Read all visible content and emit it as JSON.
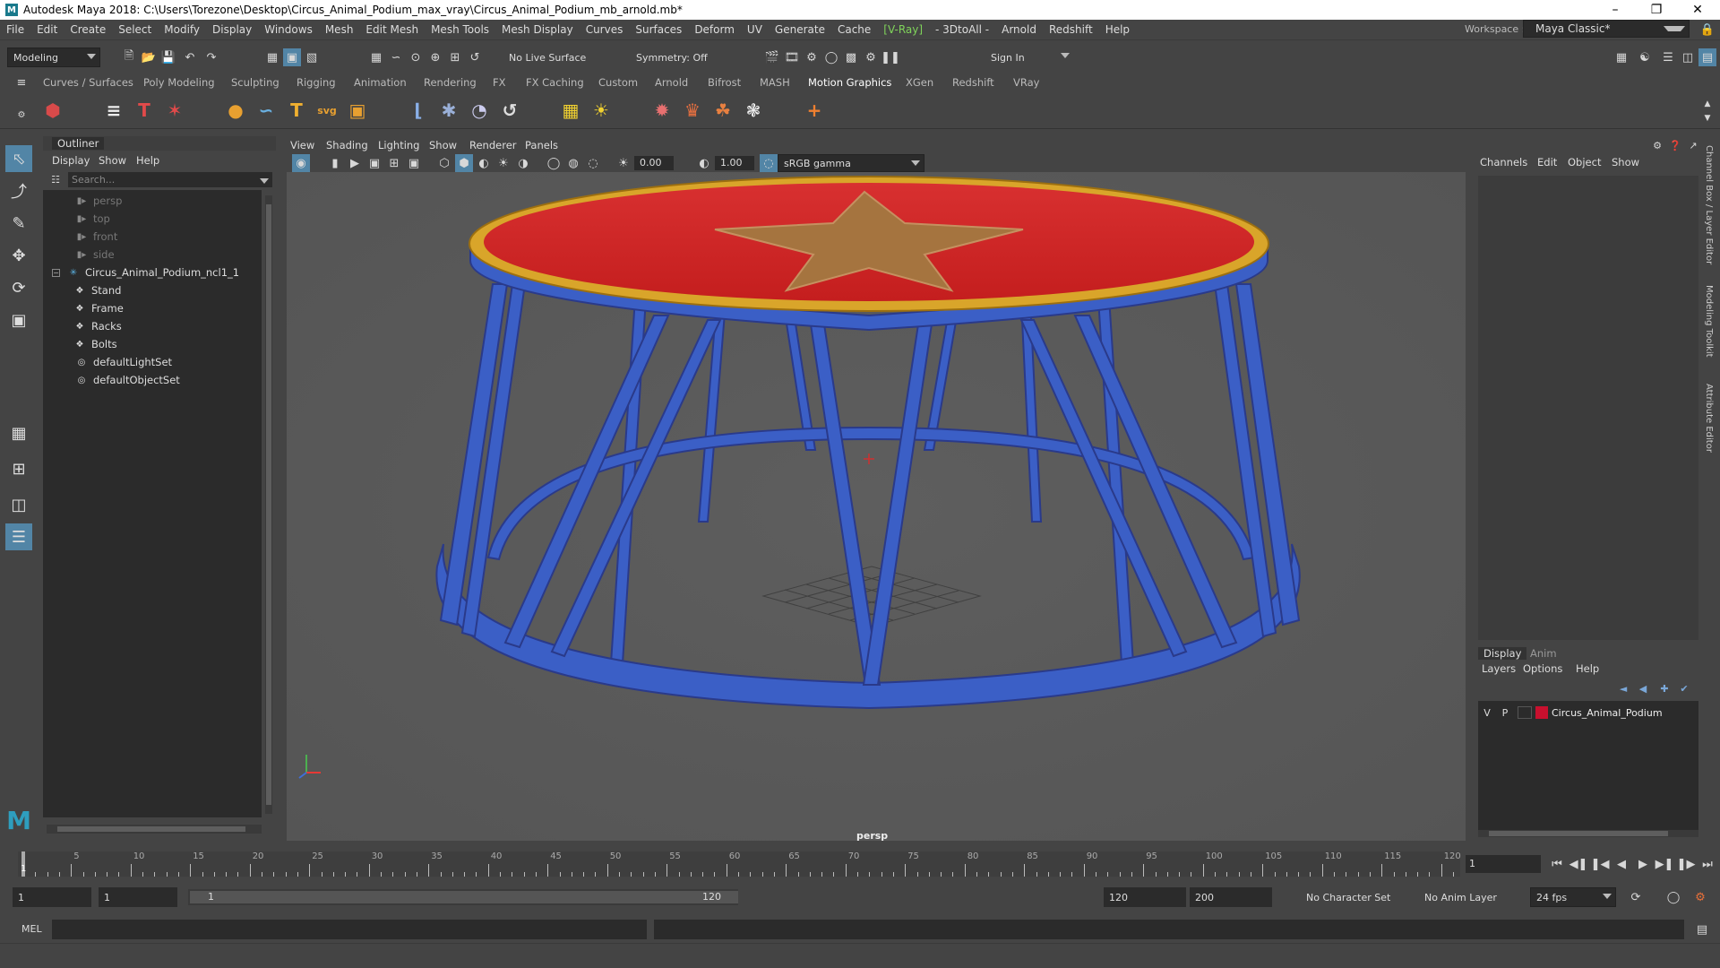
{
  "window": {
    "title": "Autodesk Maya 2018: C:\\Users\\Torezone\\Desktop\\Circus_Animal_Podium_max_vray\\Circus_Animal_Podium_mb_arnold.mb*",
    "logo": "M"
  },
  "menu": [
    "File",
    "Edit",
    "Create",
    "Select",
    "Modify",
    "Display",
    "Windows",
    "Mesh",
    "Edit Mesh",
    "Mesh Tools",
    "Mesh Display",
    "Curves",
    "Surfaces",
    "Deform",
    "UV",
    "Generate",
    "Cache",
    "[V-Ray]",
    "- 3DtoAll -",
    "Arnold",
    "Redshift",
    "Help"
  ],
  "workspace": {
    "label": "Workspace :",
    "value": "Maya Classic*"
  },
  "status": {
    "mode": "Modeling",
    "live_surface": "No Live Surface",
    "symmetry": "Symmetry: Off",
    "sign_in": "Sign In"
  },
  "shelf_tabs": [
    "Curves / Surfaces",
    "Poly Modeling",
    "Sculpting",
    "Rigging",
    "Animation",
    "Rendering",
    "FX",
    "FX Caching",
    "Custom",
    "Arnold",
    "Bifrost",
    "MASH",
    "Motion Graphics",
    "XGen",
    "Redshift",
    "VRay"
  ],
  "shelf_active": "Motion Graphics",
  "outliner": {
    "title": "Outliner",
    "menu": [
      "Display",
      "Show",
      "Help"
    ],
    "search_placeholder": "Search...",
    "items": [
      {
        "label": "persp",
        "type": "camera"
      },
      {
        "label": "top",
        "type": "camera"
      },
      {
        "label": "front",
        "type": "camera"
      },
      {
        "label": "side",
        "type": "camera"
      },
      {
        "label": "Circus_Animal_Podium_ncl1_1",
        "type": "group"
      },
      {
        "label": "Stand",
        "type": "mesh"
      },
      {
        "label": "Frame",
        "type": "mesh"
      },
      {
        "label": "Racks",
        "type": "mesh"
      },
      {
        "label": "Bolts",
        "type": "mesh"
      },
      {
        "label": "defaultLightSet",
        "type": "set"
      },
      {
        "label": "defaultObjectSet",
        "type": "set"
      }
    ]
  },
  "viewport": {
    "menu": [
      "View",
      "Shading",
      "Lighting",
      "Show",
      "Renderer",
      "Panels"
    ],
    "exposure": "0.00",
    "gamma": "1.00",
    "color_space": "sRGB gamma",
    "camera_label": "persp"
  },
  "channel_box": {
    "menu": [
      "Channels",
      "Edit",
      "Object",
      "Show"
    ]
  },
  "layer_editor": {
    "tabs": [
      "Display",
      "Anim"
    ],
    "menu": [
      "Layers",
      "Options",
      "Help"
    ],
    "layer": {
      "v": "V",
      "p": "P",
      "name": "Circus_Animal_Podium",
      "color": "#c8102e"
    }
  },
  "side_tabs": [
    "Channel Box / Layer Editor",
    "Modeling Toolkit",
    "Attribute Editor"
  ],
  "timeline": {
    "ticks": [
      "5",
      "10",
      "15",
      "20",
      "25",
      "30",
      "35",
      "40",
      "45",
      "50",
      "55",
      "60",
      "65",
      "70",
      "75",
      "80",
      "85",
      "90",
      "95",
      "100",
      "105",
      "110",
      "115",
      "120"
    ],
    "current_frame": "1",
    "current_frame_label": "1"
  },
  "range": {
    "start": "1",
    "playback_start": "1",
    "slider_start": "1",
    "slider_end": "120",
    "playback_end": "120",
    "end": "200",
    "character_set": "No Character Set",
    "anim_layer": "No Anim Layer",
    "fps": "24 fps"
  },
  "command": {
    "label": "MEL"
  },
  "colors": {
    "vray": "#7fd35a",
    "accent": "#5285a6",
    "layer": "#c8102e"
  }
}
